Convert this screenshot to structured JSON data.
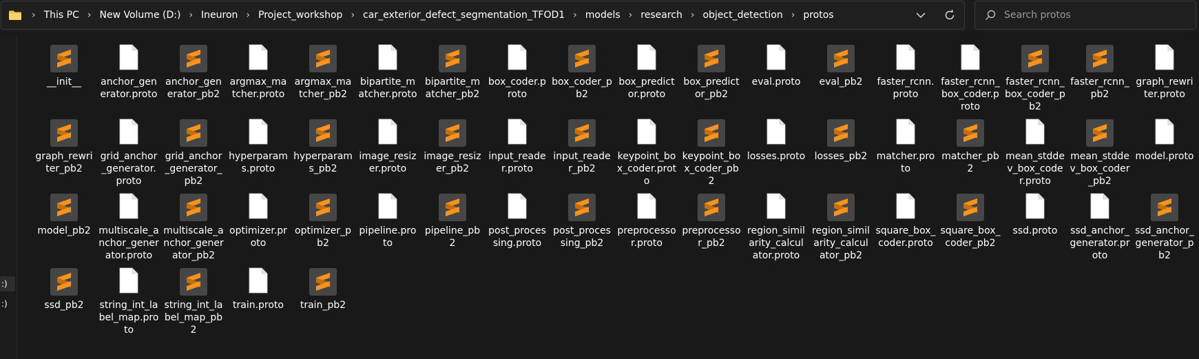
{
  "address_bar": {
    "crumbs": [
      "This PC",
      "New Volume (D:)",
      "Ineuron",
      "Project_workshop",
      "car_exterior_defect_segmentation_TFOD1",
      "models",
      "research",
      "object_detection",
      "protos"
    ]
  },
  "search": {
    "placeholder": "Search protos"
  },
  "nav_pane": {
    "drives": [
      ":)",
      ":)"
    ]
  },
  "files": [
    {
      "name": "__init__",
      "type": "sublime"
    },
    {
      "name": "anchor_generator.proto",
      "type": "doc"
    },
    {
      "name": "anchor_generator_pb2",
      "type": "sublime"
    },
    {
      "name": "argmax_matcher.proto",
      "type": "doc"
    },
    {
      "name": "argmax_matcher_pb2",
      "type": "sublime"
    },
    {
      "name": "bipartite_matcher.proto",
      "type": "doc"
    },
    {
      "name": "bipartite_matcher_pb2",
      "type": "sublime"
    },
    {
      "name": "box_coder.proto",
      "type": "doc"
    },
    {
      "name": "box_coder_pb2",
      "type": "sublime"
    },
    {
      "name": "box_predictor.proto",
      "type": "doc"
    },
    {
      "name": "box_predictor_pb2",
      "type": "sublime"
    },
    {
      "name": "eval.proto",
      "type": "doc"
    },
    {
      "name": "eval_pb2",
      "type": "sublime"
    },
    {
      "name": "faster_rcnn.proto",
      "type": "doc"
    },
    {
      "name": "faster_rcnn_box_coder.proto",
      "type": "doc"
    },
    {
      "name": "faster_rcnn_box_coder_pb2",
      "type": "sublime"
    },
    {
      "name": "faster_rcnn_pb2",
      "type": "sublime"
    },
    {
      "name": "graph_rewriter.proto",
      "type": "doc"
    },
    {
      "name": "graph_rewriter_pb2",
      "type": "sublime"
    },
    {
      "name": "grid_anchor_generator.proto",
      "type": "doc"
    },
    {
      "name": "grid_anchor_generator_pb2",
      "type": "sublime"
    },
    {
      "name": "hyperparams.proto",
      "type": "doc"
    },
    {
      "name": "hyperparams_pb2",
      "type": "sublime"
    },
    {
      "name": "image_resizer.proto",
      "type": "doc"
    },
    {
      "name": "image_resizer_pb2",
      "type": "sublime"
    },
    {
      "name": "input_reader.proto",
      "type": "doc"
    },
    {
      "name": "input_reader_pb2",
      "type": "sublime"
    },
    {
      "name": "keypoint_box_coder.proto",
      "type": "doc"
    },
    {
      "name": "keypoint_box_coder_pb2",
      "type": "sublime"
    },
    {
      "name": "losses.proto",
      "type": "doc"
    },
    {
      "name": "losses_pb2",
      "type": "sublime"
    },
    {
      "name": "matcher.proto",
      "type": "doc"
    },
    {
      "name": "matcher_pb2",
      "type": "sublime"
    },
    {
      "name": "mean_stddev_box_coder.proto",
      "type": "doc"
    },
    {
      "name": "mean_stddev_box_coder_pb2",
      "type": "sublime"
    },
    {
      "name": "model.proto",
      "type": "doc"
    },
    {
      "name": "model_pb2",
      "type": "sublime"
    },
    {
      "name": "multiscale_anchor_generator.proto",
      "type": "doc"
    },
    {
      "name": "multiscale_anchor_generator_pb2",
      "type": "sublime"
    },
    {
      "name": "optimizer.proto",
      "type": "doc"
    },
    {
      "name": "optimizer_pb2",
      "type": "sublime"
    },
    {
      "name": "pipeline.proto",
      "type": "doc"
    },
    {
      "name": "pipeline_pb2",
      "type": "sublime"
    },
    {
      "name": "post_processing.proto",
      "type": "doc"
    },
    {
      "name": "post_processing_pb2",
      "type": "sublime"
    },
    {
      "name": "preprocessor.proto",
      "type": "doc"
    },
    {
      "name": "preprocessor_pb2",
      "type": "sublime"
    },
    {
      "name": "region_similarity_calculator.proto",
      "type": "doc"
    },
    {
      "name": "region_similarity_calculator_pb2",
      "type": "sublime"
    },
    {
      "name": "square_box_coder.proto",
      "type": "doc"
    },
    {
      "name": "square_box_coder_pb2",
      "type": "sublime"
    },
    {
      "name": "ssd.proto",
      "type": "doc"
    },
    {
      "name": "ssd_anchor_generator.proto",
      "type": "doc"
    },
    {
      "name": "ssd_anchor_generator_pb2",
      "type": "sublime"
    },
    {
      "name": "ssd_pb2",
      "type": "sublime"
    },
    {
      "name": "string_int_label_map.proto",
      "type": "doc"
    },
    {
      "name": "string_int_label_map_pb2",
      "type": "sublime"
    },
    {
      "name": "train.proto",
      "type": "doc"
    },
    {
      "name": "train_pb2",
      "type": "sublime"
    }
  ],
  "colors": {
    "sublime_orange": "#f7931e",
    "icon_bg": "#464646",
    "doc_white": "#ffffff"
  }
}
